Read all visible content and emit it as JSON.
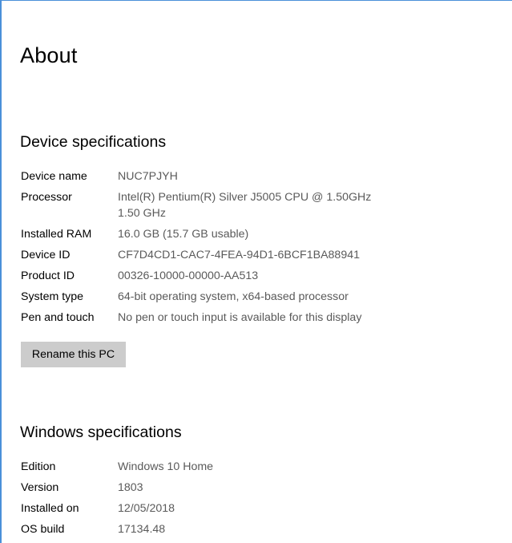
{
  "page": {
    "title": "About"
  },
  "device_specs": {
    "heading": "Device specifications",
    "rows": [
      {
        "label": "Device name",
        "value": "NUC7PJYH",
        "value2": ""
      },
      {
        "label": "Processor",
        "value": "Intel(R) Pentium(R) Silver J5005 CPU @ 1.50GHz",
        "value2": "1.50 GHz"
      },
      {
        "label": "Installed RAM",
        "value": "16.0 GB (15.7 GB usable)",
        "value2": ""
      },
      {
        "label": "Device ID",
        "value": "CF7D4CD1-CAC7-4FEA-94D1-6BCF1BA88941",
        "value2": ""
      },
      {
        "label": "Product ID",
        "value": "00326-10000-00000-AA513",
        "value2": ""
      },
      {
        "label": "System type",
        "value": "64-bit operating system, x64-based processor",
        "value2": ""
      },
      {
        "label": "Pen and touch",
        "value": "No pen or touch input is available for this display",
        "value2": ""
      }
    ],
    "rename_button_label": "Rename this PC"
  },
  "windows_specs": {
    "heading": "Windows specifications",
    "rows": [
      {
        "label": "Edition",
        "value": "Windows 10 Home"
      },
      {
        "label": "Version",
        "value": "1803"
      },
      {
        "label": "Installed on",
        "value": "12/05/2018"
      },
      {
        "label": "OS build",
        "value": "17134.48"
      }
    ]
  },
  "colors": {
    "frame_accent": "#4a90d9",
    "value_text": "#5a5a5a",
    "button_bg": "#cccccc"
  }
}
